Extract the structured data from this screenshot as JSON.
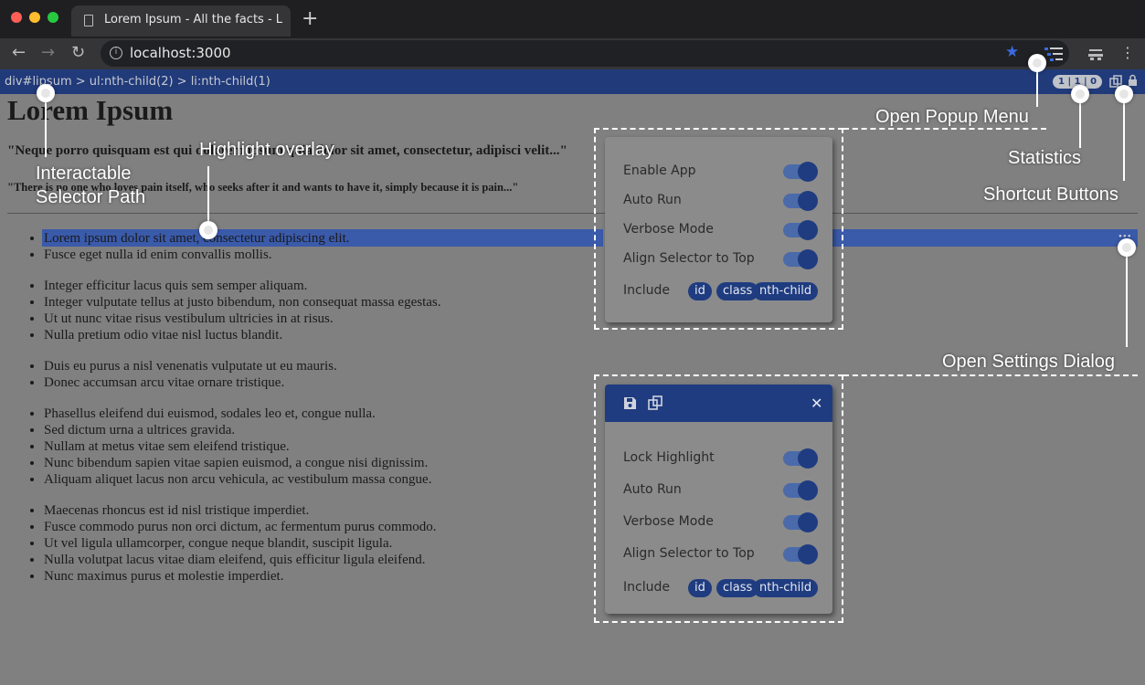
{
  "browser": {
    "tab_title": "Lorem Ipsum - All the facts - Lipsum generator",
    "new_tab": "+",
    "url": "localhost:3000",
    "back": "←",
    "forward": "→",
    "reload": "↻",
    "menu": "⋮",
    "star": "★"
  },
  "selector_bar": {
    "path": "div#lipsum > ul:nth-child(2) > li:nth-child(1)",
    "stats": "1 | 1 | 0"
  },
  "page": {
    "title": "Lorem Ipsum",
    "quote1": "\"Neque porro quisquam est qui dolorem ipsum quia dolor sit amet, consectetur, adipisci velit...\"",
    "quote2": "\"There is no one who loves pain itself, who seeks after it and wants to have it, simply because it is pain...\"",
    "lists": [
      [
        "Lorem ipsum dolor sit amet, consectetur adipiscing elit.",
        "Fusce eget nulla id enim convallis mollis."
      ],
      [
        "Integer efficitur lacus quis sem semper aliquam.",
        "Integer vulputate tellus at justo bibendum, non consequat massa egestas.",
        "Ut ut nunc vitae risus vestibulum ultricies in at risus.",
        "Nulla pretium odio vitae nisl luctus blandit."
      ],
      [
        "Duis eu purus a nisl venenatis vulputate ut eu mauris.",
        "Donec accumsan arcu vitae ornare tristique."
      ],
      [
        "Phasellus eleifend dui euismod, sodales leo et, congue nulla.",
        "Sed dictum urna a ultrices gravida.",
        "Nullam at metus vitae sem eleifend tristique.",
        "Nunc bibendum sapien vitae sapien euismod, a congue nisi dignissim.",
        "Aliquam aliquet lacus non arcu vehicula, ac vestibulum massa congue."
      ],
      [
        "Maecenas rhoncus est id nisl tristique imperdiet.",
        "Fusce commodo purus non orci dictum, ac fermentum purus commodo.",
        "Ut vel ligula ullamcorper, congue neque blandit, suscipit ligula.",
        "Nulla volutpat lacus vitae diam eleifend, quis efficitur ligula eleifend.",
        "Nunc maximus purus et molestie imperdiet."
      ]
    ]
  },
  "popup_menu": {
    "toggles": [
      "Enable App",
      "Auto Run",
      "Verbose Mode",
      "Align Selector to Top"
    ],
    "include_label": "Include",
    "chips": [
      "id",
      "class",
      "nth-child"
    ]
  },
  "settings_dialog": {
    "toggles": [
      "Lock Highlight",
      "Auto Run",
      "Verbose Mode",
      "Align Selector to Top"
    ],
    "include_label": "Include",
    "chips": [
      "id",
      "class",
      "nth-child"
    ],
    "close": "✕"
  },
  "callouts": {
    "open_popup_menu": "Open Popup Menu",
    "statistics": "Statistics",
    "shortcut_buttons": "Shortcut Buttons",
    "highlight_overlay": "Highlight overlay",
    "interactable": "Interactable",
    "selector_path": "Selector Path",
    "open_settings_dialog": "Open Settings Dialog"
  },
  "colors": {
    "accent": "#1f3c80",
    "highlight": "#3a5aaa",
    "page_dim": "#808080"
  }
}
